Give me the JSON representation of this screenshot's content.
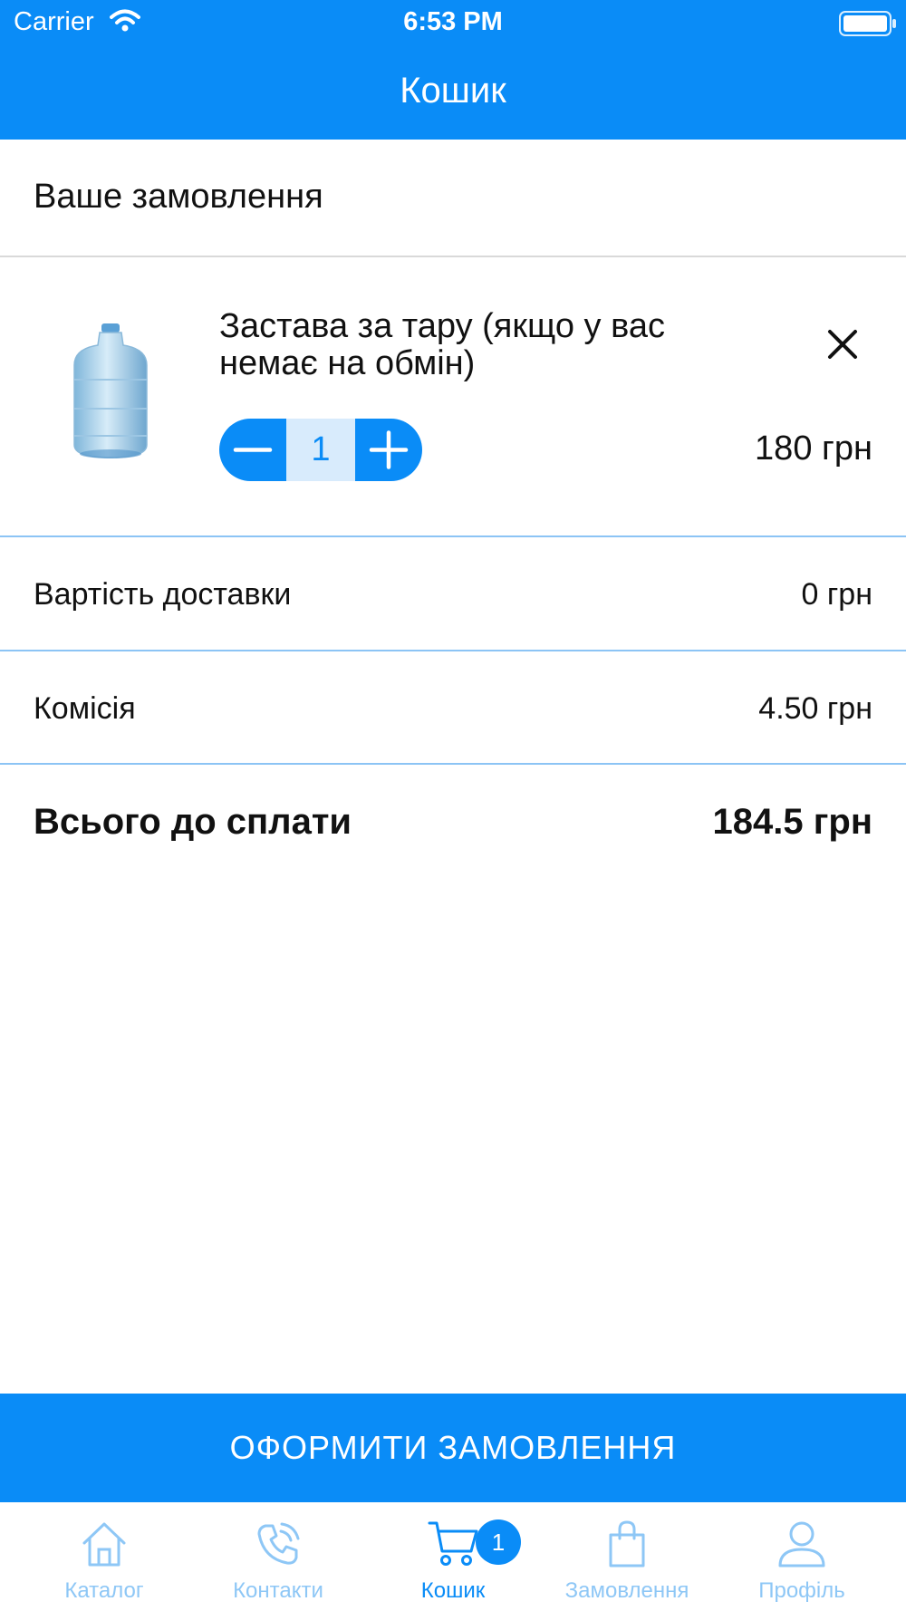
{
  "status_bar": {
    "carrier": "Carrier",
    "time": "6:53 PM"
  },
  "nav": {
    "title": "Кошик"
  },
  "order": {
    "section_title": "Ваше замовлення"
  },
  "item": {
    "title": "Застава за тару (якщо у вас немає на обмін)",
    "quantity": "1",
    "price": "180 грн",
    "image": "water-bottle"
  },
  "summary": {
    "delivery_label": "Вартість доставки",
    "delivery_value": "0 грн",
    "commission_label": "Комісія",
    "commission_value": "4.50 грн",
    "total_label": "Всього до сплати",
    "total_value": "184.5 грн"
  },
  "checkout": {
    "label": "ОФОРМИТИ ЗАМОВЛЕННЯ"
  },
  "tabbar": {
    "tabs": [
      {
        "label": "Каталог",
        "icon": "home-icon"
      },
      {
        "label": "Контакти",
        "icon": "phone-icon"
      },
      {
        "label": "Кошик",
        "icon": "cart-icon",
        "active": true
      },
      {
        "label": "Замовлення",
        "icon": "bag-icon"
      },
      {
        "label": "Профіль",
        "icon": "user-icon"
      }
    ],
    "cart_badge": "1"
  },
  "colors": {
    "accent": "#0a8cf7",
    "inactive_tab": "#8ec7f6",
    "stepper_bg": "#d8ebfc"
  }
}
